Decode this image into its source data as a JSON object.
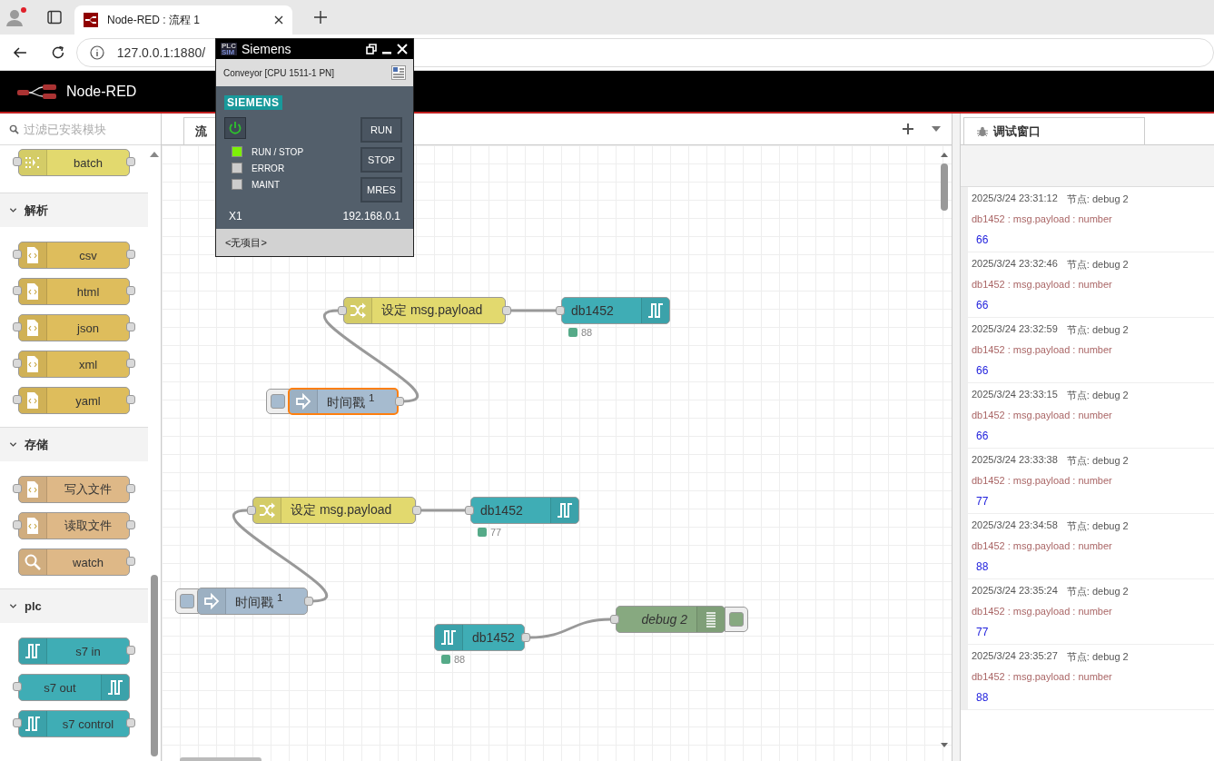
{
  "browser": {
    "tab_title": "Node-RED : 流程 1",
    "address": "127.0.0.1:1880/"
  },
  "header": {
    "title": "Node-RED"
  },
  "palette": {
    "search_placeholder": "过滤已安装模块",
    "categories": [
      {
        "nodes": [
          {
            "kind": "batch",
            "label": "batch",
            "input": true,
            "output": true
          }
        ]
      },
      {
        "name": "解析",
        "expanded": true,
        "nodes": [
          {
            "kind": "csv",
            "label": "csv",
            "input": true,
            "output": true
          },
          {
            "kind": "html",
            "label": "html",
            "input": true,
            "output": true
          },
          {
            "kind": "json",
            "label": "json",
            "input": true,
            "output": true
          },
          {
            "kind": "xml",
            "label": "xml",
            "input": true,
            "output": true
          },
          {
            "kind": "yaml",
            "label": "yaml",
            "input": true,
            "output": true
          }
        ]
      },
      {
        "name": "存储",
        "expanded": true,
        "nodes": [
          {
            "kind": "file-out",
            "label": "写入文件",
            "input": true,
            "output": true
          },
          {
            "kind": "file-in",
            "label": "读取文件",
            "input": true,
            "output": true
          },
          {
            "kind": "watch",
            "label": "watch",
            "input": false,
            "output": true
          }
        ]
      },
      {
        "name": "plc",
        "expanded": true,
        "nodes": [
          {
            "kind": "s7-in",
            "label": "s7 in",
            "input": false,
            "output": true
          },
          {
            "kind": "s7-out",
            "label": "s7 out",
            "input": true,
            "output": false
          },
          {
            "kind": "s7-control",
            "label": "s7 control",
            "input": true,
            "output": true
          }
        ]
      }
    ]
  },
  "workspace": {
    "tabs": [
      {
        "label": "流",
        "selected": true
      }
    ],
    "nodes": [
      {
        "kind": "change",
        "label": "设定 msg.payload",
        "selected": false
      },
      {
        "kind": "s7-out",
        "label": "db1452",
        "status": "88",
        "selected": false
      },
      {
        "kind": "inject",
        "label": "时间戳 $^{1}$",
        "selected": true
      },
      {
        "kind": "change",
        "label": "设定 msg.payload",
        "selected": false
      },
      {
        "kind": "s7-out",
        "label": "db1452",
        "status": "77",
        "selected": false
      },
      {
        "kind": "inject",
        "label": "时间戳 $^{1}$",
        "selected": false
      },
      {
        "kind": "s7-in",
        "label": "db1452",
        "status": "88",
        "selected": false
      },
      {
        "kind": "debug",
        "label": "debug 2",
        "selected": false
      }
    ]
  },
  "sidebar": {
    "tab": {
      "label": "调试窗口",
      "selected": true
    },
    "messages": [
      {
        "time": "2025/3/24 23:31:12",
        "node": "节点: debug 2",
        "topic": "db1452 : msg.payload : number",
        "value": "66"
      },
      {
        "time": "2025/3/24 23:32:46",
        "node": "节点: debug 2",
        "topic": "db1452 : msg.payload : number",
        "value": "66"
      },
      {
        "time": "2025/3/24 23:32:59",
        "node": "节点: debug 2",
        "topic": "db1452 : msg.payload : number",
        "value": "66"
      },
      {
        "time": "2025/3/24 23:33:15",
        "node": "节点: debug 2",
        "topic": "db1452 : msg.payload : number",
        "value": "66"
      },
      {
        "time": "2025/3/24 23:33:38",
        "node": "节点: debug 2",
        "topic": "db1452 : msg.payload : number",
        "value": "77"
      },
      {
        "time": "2025/3/24 23:34:58",
        "node": "节点: debug 2",
        "topic": "db1452 : msg.payload : number",
        "value": "88"
      },
      {
        "time": "2025/3/24 23:35:24",
        "node": "节点: debug 2",
        "topic": "db1452 : msg.payload : number",
        "value": "77"
      },
      {
        "time": "2025/3/24 23:35:27",
        "node": "节点: debug 2",
        "topic": "db1452 : msg.payload : number",
        "value": "88"
      }
    ]
  },
  "plcsim": {
    "badge": [
      "PLC",
      "SIM"
    ],
    "title": "Siemens",
    "project": "Conveyor [CPU 1511-1 PN]",
    "brand": "SIEMENS",
    "power_on": true,
    "leds": [
      {
        "label": "RUN / STOP",
        "on": true
      },
      {
        "label": "ERROR",
        "on": false
      },
      {
        "label": "MAINT",
        "on": false
      }
    ],
    "buttons": [
      "RUN",
      "STOP",
      "MRES"
    ],
    "interface": "X1",
    "ip": "192.168.0.1",
    "footer": "<无项目>"
  }
}
